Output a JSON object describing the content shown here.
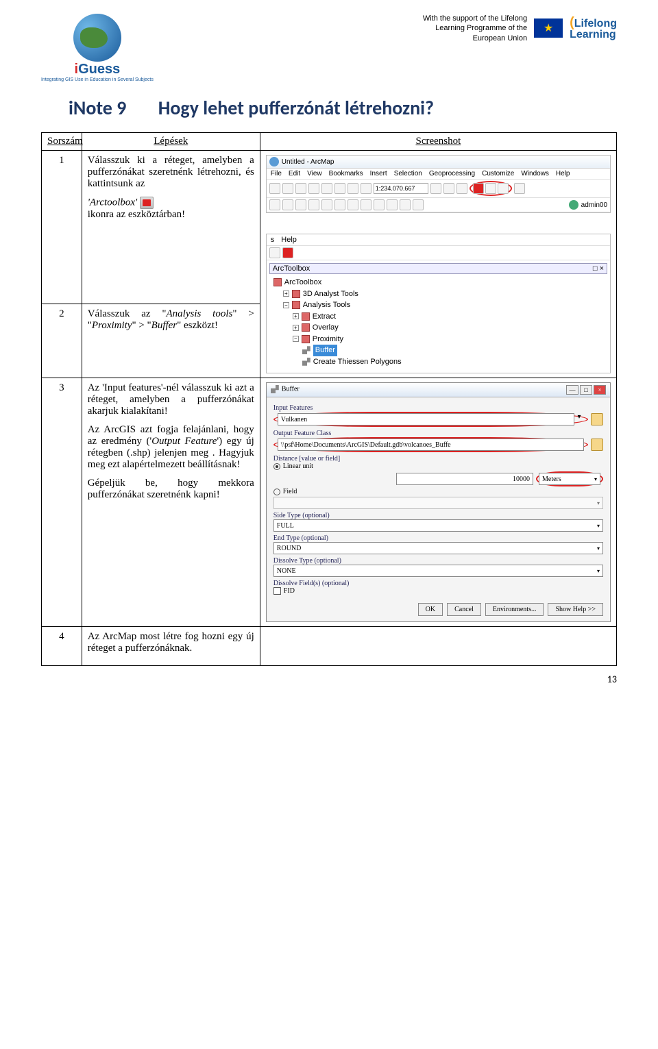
{
  "header": {
    "logo_brand_i": "i",
    "logo_brand_rest": "Guess",
    "logo_tagline": "Integrating GIS Use in Education in Several Subjects",
    "support_line1": "With the support of the Lifelong",
    "support_line2": "Learning Programme of the",
    "support_line3": "European Union",
    "lifelong_top": "Lifelong",
    "lifelong_bottom": "Learning"
  },
  "title": {
    "inote": "iNote 9",
    "question": "Hogy lehet pufferzónát létrehozni?"
  },
  "table_headers": {
    "num": "Sorszám",
    "step": "Lépések",
    "shot": "Screenshot"
  },
  "rows": {
    "r1": {
      "num": "1",
      "p1": "Válasszuk ki a réteget, amelyben a pufferzónákat szeretnénk létrehozni, és kattintsunk az",
      "p2a": "'Arctoolbox'",
      "p2b": "ikonra az eszköztárban!"
    },
    "r2": {
      "num": "2",
      "p1a": "Válasszuk az \"",
      "p1b": "Analysis tools",
      "p1c": "\" > \"",
      "p1d": "Proximity",
      "p1e": "\" > \"",
      "p1f": "Buffer",
      "p1g": "\" eszközt!"
    },
    "r3": {
      "num": "3",
      "p1a": "Az '",
      "p1b": "Input features",
      "p1c": "'-nél válasszuk ki azt a réteget, amelyben a pufferzónákat akarjuk kialakítani!",
      "p2a": "Az ArcGIS azt fogja felajánlani, hogy az eredmény ('",
      "p2b": "Output Feature",
      "p2c": "') egy új rétegben (.shp) jelenjen meg . Hagyjuk meg ezt alapértelmezett beállításnak!",
      "p3": "Gépeljük be, hogy mekkora pufferzónákat szeretnénk kapni!"
    },
    "r4": {
      "num": "4",
      "p1": "Az ArcMap most létre fog hozni egy új réteget a pufferzónáknak."
    }
  },
  "shot1": {
    "title": "Untitled - ArcMap",
    "menu": [
      "File",
      "Edit",
      "View",
      "Bookmarks",
      "Insert",
      "Selection",
      "Geoprocessing",
      "Customize",
      "Windows",
      "Help"
    ],
    "scale": "1:234.070.667",
    "user": "admin00"
  },
  "shot2": {
    "menu_s": "s",
    "menu_help": "Help",
    "panel": "ArcToolbox",
    "panel_close": "□ ×",
    "items": {
      "root": "ArcToolbox",
      "a3d": "3D Analyst Tools",
      "analysis": "Analysis Tools",
      "extract": "Extract",
      "overlay": "Overlay",
      "proximity": "Proximity",
      "buffer": "Buffer",
      "ctp": "Create Thiessen Polygons"
    }
  },
  "shot3": {
    "title": "Buffer",
    "labels": {
      "input": "Input Features",
      "output": "Output Feature Class",
      "distance": "Distance [value or field]",
      "linear": "Linear unit",
      "field": "Field",
      "side": "Side Type (optional)",
      "end": "End Type (optional)",
      "dissolve": "Dissolve Type (optional)",
      "dfields": "Dissolve Field(s) (optional)"
    },
    "values": {
      "input": "Vulkanen",
      "output": "\\\\psf\\Home\\Documents\\ArcGIS\\Default.gdb\\volcanoes_Buffe",
      "distance_num": "10000",
      "distance_unit": "Meters",
      "side": "FULL",
      "end": "ROUND",
      "dissolve": "NONE",
      "fid": "FID"
    },
    "buttons": {
      "ok": "OK",
      "cancel": "Cancel",
      "env": "Environments...",
      "help": "Show Help >>"
    }
  },
  "page_number": "13"
}
